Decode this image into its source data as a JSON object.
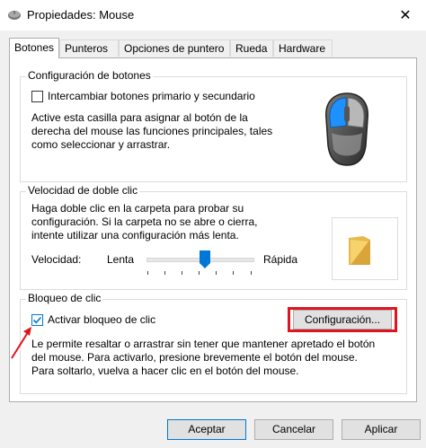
{
  "window": {
    "title": "Propiedades: Mouse",
    "close_glyph": "✕"
  },
  "tabs": [
    {
      "label": "Botones",
      "active": true
    },
    {
      "label": "Punteros",
      "active": false
    },
    {
      "label": "Opciones de puntero",
      "active": false
    },
    {
      "label": "Rueda",
      "active": false
    },
    {
      "label": "Hardware",
      "active": false
    }
  ],
  "button_config": {
    "title": "Configuración de botones",
    "swap_label": "Intercambiar botones primario y secundario",
    "swap_checked": false,
    "description": [
      "Active esta casilla para asignar al botón de la",
      "derecha del mouse las funciones principales, tales",
      "como seleccionar y arrastrar."
    ],
    "image_icon": "mouse-icon"
  },
  "double_click": {
    "title": "Velocidad de doble clic",
    "description": [
      "Haga doble clic en la carpeta para probar su",
      "configuración. Si la carpeta no se abre o cierra,",
      "intente utilizar una configuración más lenta."
    ],
    "speed_label": "Velocidad:",
    "slow_label": "Lenta",
    "fast_label": "Rápida",
    "speed_fraction": 0.55,
    "folder_icon": "folder-icon"
  },
  "click_lock": {
    "title": "Bloqueo de clic",
    "enable_label": "Activar bloqueo de clic",
    "enable_checked": true,
    "settings_button": "Configuración...",
    "description": [
      "Le permite resaltar o arrastrar sin tener que mantener apretado el botón",
      "del mouse. Para activarlo, presione brevemente el botón del mouse.",
      "Para soltarlo, vuelva a hacer clic en el botón del mouse."
    ]
  },
  "footer": {
    "ok": "Aceptar",
    "cancel": "Cancelar",
    "apply": "Aplicar"
  },
  "colors": {
    "accent": "#0078d7",
    "annotation_red": "#e0141e"
  }
}
